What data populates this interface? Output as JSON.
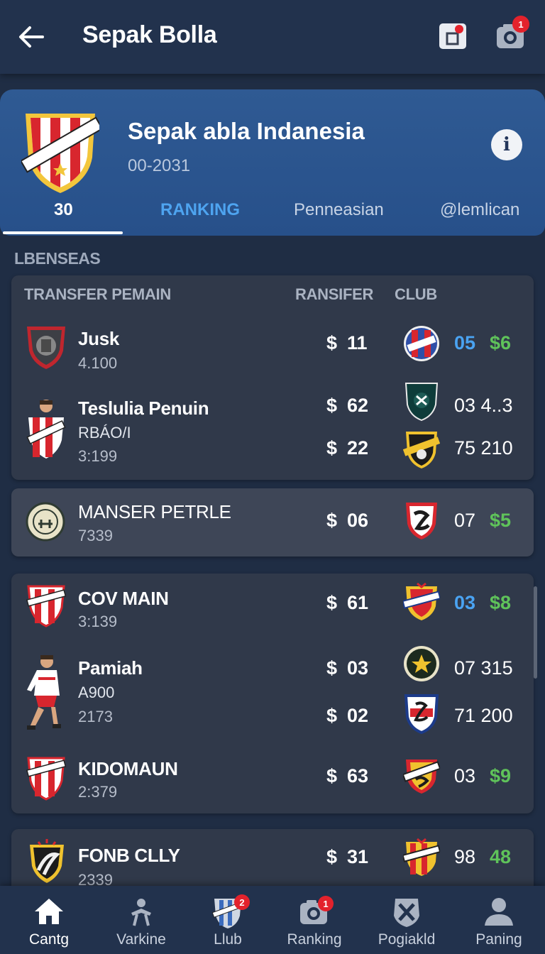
{
  "app": {
    "title": "Sepak Bolla"
  },
  "topbar": {
    "notif_badge": "1"
  },
  "hero": {
    "title": "Sepak abla Indanesia",
    "subtitle": "00-2031",
    "tabs": [
      {
        "label": "30",
        "color": "#ffffff"
      },
      {
        "label": "RANKING",
        "color": "#4ea4f0"
      },
      {
        "label": "Penneasian",
        "color": "#c8d4e6"
      },
      {
        "label": "@lemlican",
        "color": "#c8d4e6"
      }
    ]
  },
  "section": {
    "label": "LBENSEAS"
  },
  "table": {
    "headers": {
      "player": "TRANSFER PEMAIN",
      "transfer": "RANSIFER",
      "club": "CLUB"
    }
  },
  "rows": [
    {
      "name": "Jusk",
      "sub": "4.100",
      "price": {
        "currency": "$",
        "value": "11"
      },
      "stats": [
        {
          "text": "05",
          "style": "blue"
        },
        {
          "text": "$6",
          "style": "green"
        }
      ]
    },
    {
      "name": "Teslulia Penuin",
      "sub2": "RBÁO/I",
      "sub": "3:199",
      "price": {
        "currency": "$",
        "value": "62"
      },
      "stats": [
        {
          "text": "03 4..3",
          "style": "white"
        }
      ],
      "price2": {
        "currency": "$",
        "value": "22"
      },
      "stats2": [
        {
          "text": "75 210",
          "style": "white"
        }
      ]
    },
    {
      "name": "MANSER PETRLE",
      "sub": "7339",
      "price": {
        "currency": "$",
        "value": "06"
      },
      "stats": [
        {
          "text": "07",
          "style": "white"
        },
        {
          "text": "$5",
          "style": "green"
        }
      ]
    },
    {
      "name": "COV MAIN",
      "sub": "3:139",
      "price": {
        "currency": "$",
        "value": "61"
      },
      "stats": [
        {
          "text": "03",
          "style": "blue"
        },
        {
          "text": "$8",
          "style": "green"
        }
      ]
    },
    {
      "name": "Pamiah",
      "sub2": "A900",
      "sub": "2173",
      "price": {
        "currency": "$",
        "value": "03"
      },
      "stats": [
        {
          "text": "07 315",
          "style": "white"
        }
      ],
      "price2": {
        "currency": "$",
        "value": "02"
      },
      "stats2": [
        {
          "text": "71 200",
          "style": "white"
        }
      ]
    },
    {
      "name": "KIDOMAUN",
      "sub": "2:379",
      "price": {
        "currency": "$",
        "value": "63"
      },
      "stats": [
        {
          "text": "03",
          "style": "white"
        },
        {
          "text": "$9",
          "style": "green"
        }
      ]
    },
    {
      "name": "FONB CLLY",
      "sub": "2339",
      "price": {
        "currency": "$",
        "value": "31"
      },
      "stats": [
        {
          "text": "98",
          "style": "white"
        },
        {
          "text": "48",
          "style": "green"
        }
      ]
    }
  ],
  "nav": [
    {
      "label": "Cantg",
      "icon": "home-icon"
    },
    {
      "label": "Varkine",
      "icon": "tactics-icon"
    },
    {
      "label": "Llub",
      "icon": "club-shield-icon",
      "badge": "2"
    },
    {
      "label": "Ranking",
      "icon": "camera-icon",
      "badge": "1"
    },
    {
      "label": "Pogiakld",
      "icon": "ball-icon"
    },
    {
      "label": "Paning",
      "icon": "profile-icon"
    }
  ],
  "colors": {
    "accent_blue": "#4aa3f2",
    "accent_green": "#5fc35a",
    "badge_red": "#e3222c",
    "card": "#30394a",
    "background": "#1f2d44"
  }
}
